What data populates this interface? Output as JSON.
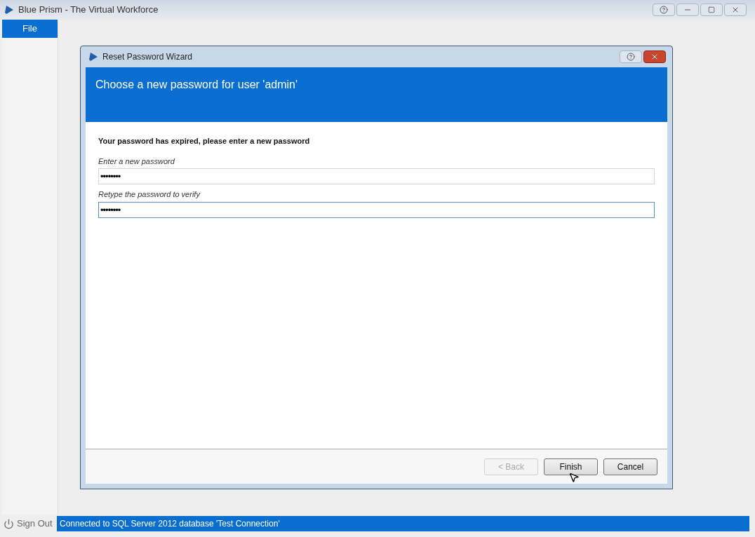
{
  "window": {
    "title": "Blue Prism - The Virtual Workforce"
  },
  "menu": [
    {
      "label": "File",
      "selected": true
    }
  ],
  "dialog": {
    "title": "Reset Password Wizard",
    "heading": "Choose a new password for user 'admin'",
    "message": "Your password has expired, please enter a new password",
    "fields": [
      {
        "label": "Enter a new password",
        "value": "••••••••",
        "focused": false
      },
      {
        "label": "Retype the password to verify",
        "value": "••••••••",
        "focused": true
      }
    ],
    "buttons": [
      {
        "label": "< Back",
        "disabled": true
      },
      {
        "label": "Finish",
        "disabled": false
      },
      {
        "label": "Cancel",
        "disabled": false
      }
    ]
  },
  "sign_out": "Sign Out",
  "status_bar": "Connected to SQL Server 2012 database 'Test Connection'"
}
